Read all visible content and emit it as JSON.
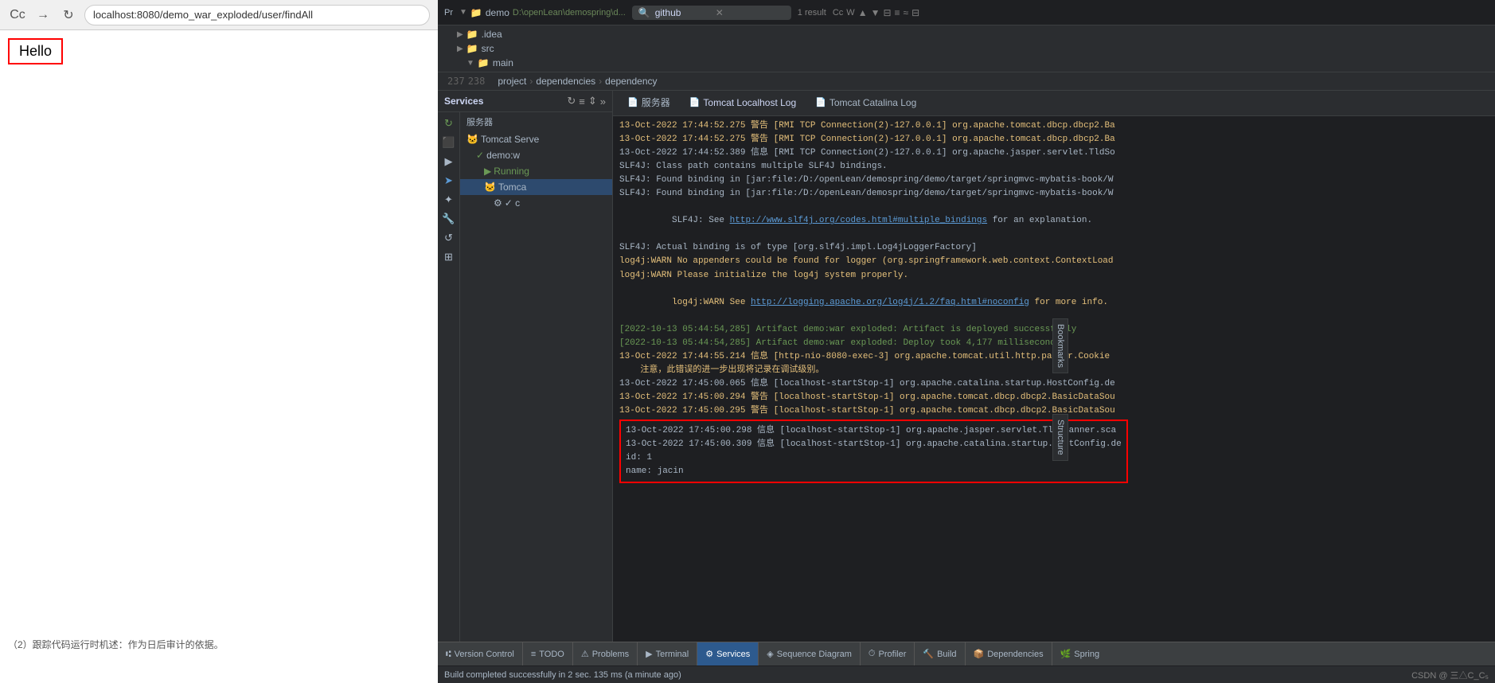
{
  "browser": {
    "url": "localhost:8080/demo_war_exploded/user/findAll",
    "back_btn": "←",
    "forward_btn": "→",
    "refresh_btn": "↻",
    "content": "Hello"
  },
  "ide": {
    "topbar": {
      "project_name": "demo",
      "project_path": "D:\\openLean\\demospring\\d...",
      "search_text": "github",
      "search_results": "1 result",
      "cc": "Cc",
      "w": "W"
    },
    "file_tree": {
      "items": [
        {
          "indent": 1,
          "arrow": "▶",
          "icon": "📁",
          "label": ".idea"
        },
        {
          "indent": 1,
          "arrow": "▶",
          "icon": "📁",
          "label": "src"
        },
        {
          "indent": 2,
          "arrow": "▼",
          "icon": "📁",
          "label": "main"
        }
      ]
    },
    "breadcrumb": {
      "items": [
        "project",
        "dependencies",
        "dependency"
      ]
    },
    "line_numbers": {
      "num1": "237",
      "num2": "238"
    },
    "services": {
      "title": "Services",
      "toolbar": {
        "reload": "↻",
        "collapse": "≡",
        "expand": "⇕",
        "more": "»"
      },
      "server_label": "服务器",
      "tabs": [
        {
          "label": "Tomcat Localhost Log",
          "icon": "📄"
        },
        {
          "label": "Tomcat Catalina Log",
          "icon": "📄"
        }
      ],
      "tree": [
        {
          "indent": 0,
          "icon": "🐱",
          "label": "Tomcat Serve",
          "status": "",
          "has_check": false
        },
        {
          "indent": 1,
          "icon": "✓",
          "label": "demo:w",
          "status": "green",
          "has_check": true
        },
        {
          "indent": 2,
          "icon": "▶",
          "label": "Running",
          "status": "green",
          "has_check": false
        },
        {
          "indent": 2,
          "icon": "🐱",
          "label": "Tomca",
          "status": "blue",
          "has_check": false,
          "selected": true
        },
        {
          "indent": 3,
          "icon": "⚙",
          "label": "✓ c",
          "status": "",
          "has_check": true
        }
      ],
      "action_icons": [
        "↻",
        "⬛",
        "▶",
        "➤",
        "✦",
        "🔧",
        "↺",
        "⊞"
      ]
    },
    "log": {
      "lines": [
        {
          "type": "warn",
          "text": "13-Oct-2022 17:44:52.275 警告 [RMI TCP Connection(2)-127.0.0.1] org.apache.tomcat.dbcp.dbcp2.Ba"
        },
        {
          "type": "warn",
          "text": "13-Oct-2022 17:44:52.275 警告 [RMI TCP Connection(2)-127.0.0.1] org.apache.tomcat.dbcp.dbcp2.Ba"
        },
        {
          "type": "info",
          "text": "13-Oct-2022 17:44:52.389 信息 [RMI TCP Connection(2)-127.0.0.1] org.apache.jasper.servlet.TldSo"
        },
        {
          "type": "info",
          "text": "SLF4J: Class path contains multiple SLF4J bindings."
        },
        {
          "type": "info",
          "text": "SLF4J: Found binding in [jar:file:/D:/openLean/demospring/demo/target/springmvc-mybatis-book/W"
        },
        {
          "type": "info",
          "text": "SLF4J: Found binding in [jar:file:/D:/openLean/demospring/demo/target/springmvc-mybatis-book/W"
        },
        {
          "type": "link",
          "prefix": "SLF4J: See ",
          "link": "http://www.slf4j.org/codes.html#multiple_bindings",
          "suffix": " for an explanation."
        },
        {
          "type": "info",
          "text": "SLF4J: Actual binding is of type [org.slf4j.impl.Log4jLoggerFactory]"
        },
        {
          "type": "warn",
          "text": "log4j:WARN No appenders could be found for logger (org.springframework.web.context.ContextLoad"
        },
        {
          "type": "warn",
          "text": "log4j:WARN Please initialize the log4j system properly."
        },
        {
          "type": "link2",
          "prefix": "log4j:WARN See ",
          "link": "http://logging.apache.org/log4j/1.2/faq.html#noconfig",
          "suffix": " for more info."
        },
        {
          "type": "success",
          "text": "[2022-10-13 05:44:54,285] Artifact demo:war exploded: Artifact is deployed successfully"
        },
        {
          "type": "success",
          "text": "[2022-10-13 05:44:54,285] Artifact demo:war exploded: Deploy took 4,177 milliseconds"
        },
        {
          "type": "warn2",
          "text": "13-Oct-2022 17:44:55.214 信息 [http-nio-8080-exec-3] org.apache.tomcat.util.http.parser.Cookie"
        },
        {
          "type": "warn2",
          "text": "    注意，此错误的进一步出现将记录在调试级别。"
        },
        {
          "type": "info",
          "text": "13-Oct-2022 17:45:00.065 信息 [localhost-startStop-1] org.apache.catalina.startup.HostConfig.de"
        },
        {
          "type": "warn",
          "text": "13-Oct-2022 17:45:00.294 警告 [localhost-startStop-1] org.apache.tomcat.dbcp.dbcp2.BasicDataSou"
        },
        {
          "type": "warn",
          "text": "13-Oct-2022 17:45:00.295 警告 [localhost-startStop-1] org.apache.tomcat.dbcp.dbcp2.BasicDataSou"
        },
        {
          "type": "highlighted_start",
          "text": "13-Oct-2022 17:45:00.298 信息 [localhost-startStop-1] org.apache.jasper.servlet.TldScanner.sca"
        },
        {
          "type": "highlighted",
          "text": "13-Oct-2022 17:45:00.309 信息 [localhost-startStop-1] org.apache.catalina.startup.HostConfig.de"
        },
        {
          "type": "highlighted",
          "text": "id: 1"
        },
        {
          "type": "highlighted_end",
          "text": "name: jacin"
        }
      ]
    },
    "statusbar": {
      "items": [
        {
          "icon": "⑆",
          "label": "Version Control"
        },
        {
          "icon": "≡",
          "label": "TODO"
        },
        {
          "icon": "⚠",
          "label": "Problems"
        },
        {
          "icon": "▶",
          "label": "Terminal"
        },
        {
          "icon": "⚙",
          "label": "Services",
          "active": true
        },
        {
          "icon": "◈",
          "label": "Sequence Diagram"
        },
        {
          "icon": "⏱",
          "label": "Profiler"
        },
        {
          "icon": "🔨",
          "label": "Build"
        },
        {
          "icon": "📦",
          "label": "Dependencies"
        },
        {
          "icon": "🌿",
          "label": "Spring"
        }
      ]
    },
    "bottom_info": {
      "left": "Build completed successfully in 2 sec. 135 ms (a minute ago)",
      "right": "CSDN @ 三△C_C₅"
    }
  }
}
